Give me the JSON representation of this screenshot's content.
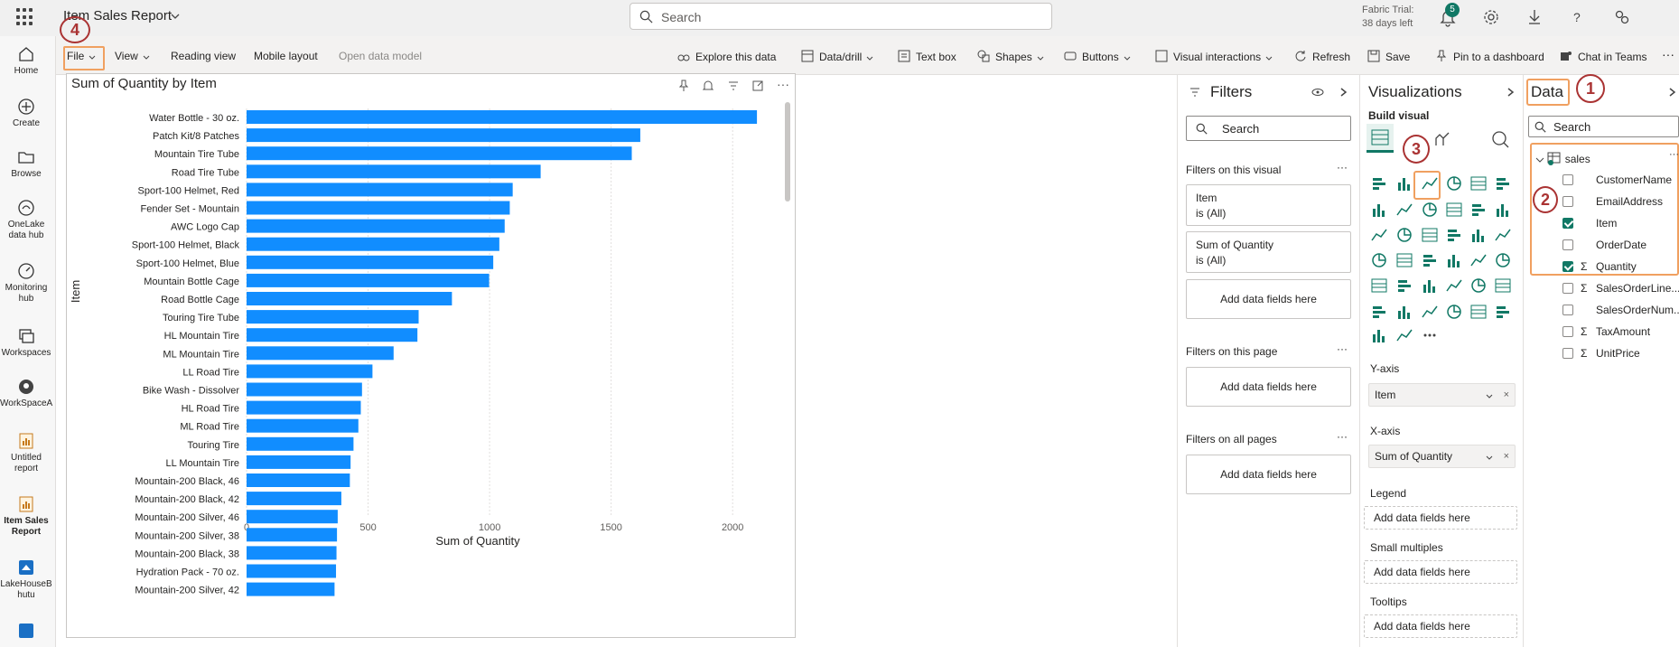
{
  "app": {
    "report_title": "Item Sales Report",
    "search_placeholder": "Search",
    "trial_line1": "Fabric Trial:",
    "trial_line2": "38 days left",
    "notification_count": "5"
  },
  "left_rail": [
    {
      "label": "Home",
      "icon": "home-icon"
    },
    {
      "label": "Create",
      "icon": "plus-circle-icon"
    },
    {
      "label": "Browse",
      "icon": "folder-icon"
    },
    {
      "label": "OneLake data hub",
      "icon": "onelake-icon"
    },
    {
      "label": "Monitoring hub",
      "icon": "monitor-icon"
    },
    {
      "label": "Workspaces",
      "icon": "workspaces-icon"
    },
    {
      "label": "WorkSpaceA",
      "icon": "workspace-avatar-icon"
    },
    {
      "label": "Untitled report",
      "icon": "report-icon"
    },
    {
      "label": "Item Sales Report",
      "icon": "report-icon"
    },
    {
      "label": "LakeHouseB hutu",
      "icon": "lakehouse-icon"
    }
  ],
  "ribbon": {
    "file": "File",
    "view": "View",
    "reading_view": "Reading view",
    "mobile_layout": "Mobile layout",
    "open_data_model": "Open data model",
    "explore": "Explore this data",
    "data_drill": "Data/drill",
    "text_box": "Text box",
    "shapes": "Shapes",
    "buttons": "Buttons",
    "visual_interactions": "Visual interactions",
    "refresh": "Refresh",
    "save": "Save",
    "pin": "Pin to a dashboard",
    "chat": "Chat in Teams",
    "more": "···"
  },
  "chart_data": {
    "type": "bar",
    "orientation": "horizontal",
    "title": "Sum of Quantity by Item",
    "xlabel": "Sum of Quantity",
    "ylabel": "Item",
    "xlim": [
      0,
      2200
    ],
    "xticks": [
      0,
      500,
      1000,
      1500,
      2000
    ],
    "grid": true,
    "color": "#118DFF",
    "categories": [
      "Water Bottle - 30 oz.",
      "Patch Kit/8 Patches",
      "Mountain Tire Tube",
      "Road Tire Tube",
      "Sport-100 Helmet, Red",
      "Fender Set - Mountain",
      "AWC Logo Cap",
      "Sport-100 Helmet, Black",
      "Sport-100 Helmet, Blue",
      "Mountain Bottle Cage",
      "Road Bottle Cage",
      "Touring Tire Tube",
      "HL Mountain Tire",
      "ML Mountain Tire",
      "LL Road Tire",
      "Bike Wash - Dissolver",
      "HL Road Tire",
      "ML Road Tire",
      "Touring Tire",
      "LL Mountain Tire",
      "Mountain-200 Black, 46",
      "Mountain-200 Black, 42",
      "Mountain-200 Silver, 46",
      "Mountain-200 Silver, 38",
      "Mountain-200 Black, 38",
      "Hydration Pack - 70 oz.",
      "Mountain-200 Silver, 42"
    ],
    "values": [
      2100,
      1620,
      1585,
      1210,
      1095,
      1083,
      1062,
      1040,
      1015,
      998,
      845,
      708,
      703,
      605,
      518,
      475,
      470,
      460,
      440,
      428,
      425,
      390,
      375,
      372,
      370,
      368,
      362
    ]
  },
  "filters": {
    "title": "Filters",
    "search": "Search",
    "on_visual": "Filters on this visual",
    "cards": [
      {
        "name": "Item",
        "state": "is (All)"
      },
      {
        "name": "Sum of Quantity",
        "state": "is (All)"
      }
    ],
    "add": "Add data fields here",
    "on_page": "Filters on this page",
    "on_all": "Filters on all pages",
    "more": "···"
  },
  "visualizations": {
    "title": "Visualizations",
    "build_visual": "Build visual",
    "y_axis": "Y-axis",
    "y_field": "Item",
    "x_axis": "X-axis",
    "x_field": "Sum of Quantity",
    "legend": "Legend",
    "small_multiples": "Small multiples",
    "tooltips": "Tooltips",
    "add": "Add data fields here",
    "remove": "×",
    "more": "···"
  },
  "data_pane": {
    "title": "Data",
    "search": "Search",
    "table": "sales",
    "fields": [
      {
        "name": "CustomerName",
        "checked": false,
        "sigma": false
      },
      {
        "name": "EmailAddress",
        "checked": false,
        "sigma": false
      },
      {
        "name": "Item",
        "checked": true,
        "sigma": false
      },
      {
        "name": "OrderDate",
        "checked": false,
        "sigma": false
      },
      {
        "name": "Quantity",
        "checked": true,
        "sigma": true
      },
      {
        "name": "SalesOrderLine...",
        "checked": false,
        "sigma": true
      },
      {
        "name": "SalesOrderNum...",
        "checked": false,
        "sigma": false
      },
      {
        "name": "TaxAmount",
        "checked": false,
        "sigma": true
      },
      {
        "name": "UnitPrice",
        "checked": false,
        "sigma": true
      }
    ]
  },
  "annotations": [
    "1",
    "2",
    "3",
    "4"
  ],
  "colors": {
    "accent": "#117865",
    "bar": "#118DFF",
    "annotation": "#AA3333",
    "highlight": "#F0A060"
  }
}
